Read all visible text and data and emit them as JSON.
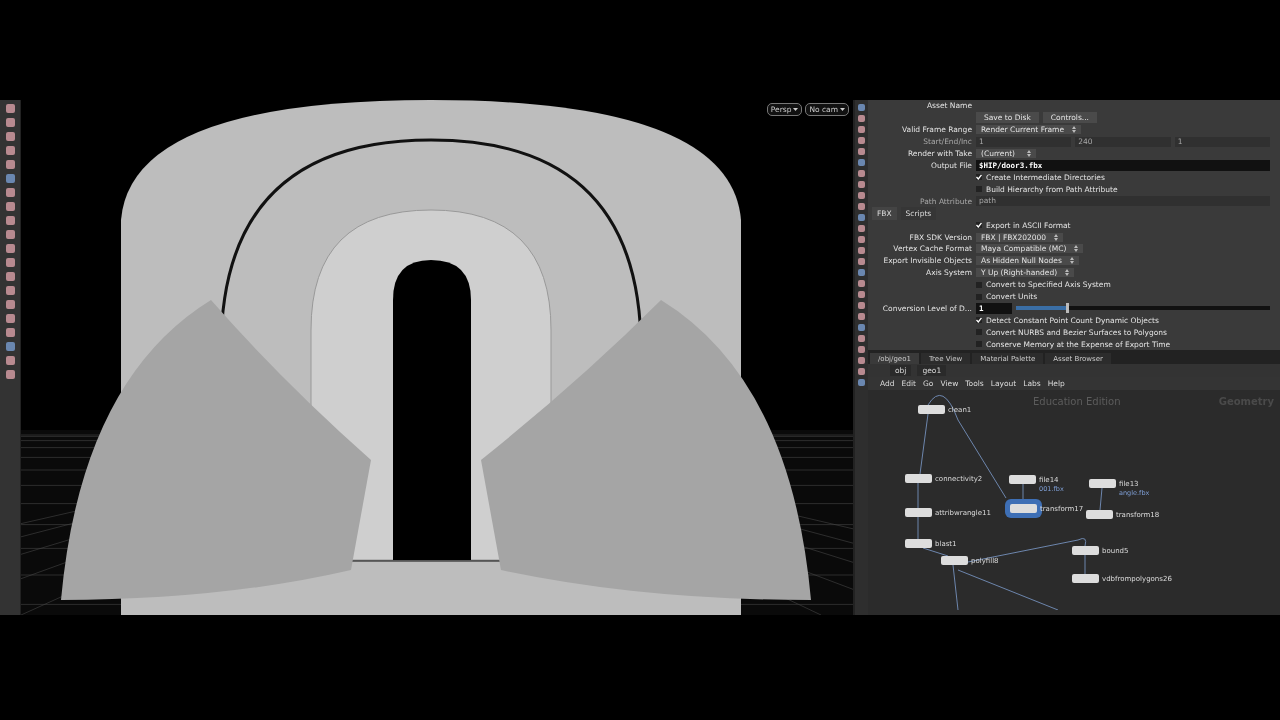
{
  "viewport": {
    "buttons": [
      "Persp",
      "No cam"
    ]
  },
  "parameters": {
    "asset_label": "Asset Name",
    "rows": [
      {
        "kind": "buttons",
        "buttons": [
          "Save to Disk",
          "Controls..."
        ],
        "disabled": false
      },
      {
        "kind": "menu",
        "label": "Valid Frame Range",
        "value": "Render Current Frame",
        "disabled": false
      },
      {
        "kind": "triple",
        "label": "Start/End/Inc",
        "values": [
          "1",
          "240",
          "1"
        ],
        "disabled": true
      },
      {
        "kind": "menu",
        "label": "Render with Take",
        "value": "(Current)",
        "disabled": false
      },
      {
        "kind": "file",
        "label": "Output File",
        "value": "$HIP/door3.fbx",
        "disabled": false
      },
      {
        "kind": "check",
        "label": "Create Intermediate Directories",
        "checked": true,
        "disabled": false
      },
      {
        "kind": "check",
        "label": "Build Hierarchy from Path Attribute",
        "checked": false,
        "disabled": false
      },
      {
        "kind": "field",
        "label": "Path Attribute",
        "value": "path",
        "disabled": true
      },
      {
        "kind": "tabs",
        "tabs": [
          {
            "label": "FBX",
            "selected": true
          },
          {
            "label": "Scripts",
            "selected": false
          }
        ],
        "disabled": false
      },
      {
        "kind": "check",
        "label": "Export in ASCII Format",
        "checked": true,
        "disabled": false
      },
      {
        "kind": "menu",
        "label": "FBX SDK Version",
        "value": "FBX | FBX202000",
        "disabled": false
      },
      {
        "kind": "menu",
        "label": "Vertex Cache Format",
        "value": "Maya Compatible (MC)",
        "disabled": false
      },
      {
        "kind": "menu",
        "label": "Export Invisible Objects",
        "value": "As Hidden Null Nodes",
        "disabled": false
      },
      {
        "kind": "menu",
        "label": "Axis System",
        "value": "Y Up (Right-handed)",
        "disabled": false
      },
      {
        "kind": "check",
        "label": "Convert to Specified Axis System",
        "checked": false,
        "disabled": false
      },
      {
        "kind": "check",
        "label": "Convert Units",
        "checked": false,
        "disabled": false
      },
      {
        "kind": "slider",
        "label": "Conversion Level of D...",
        "value": "1",
        "level": 0.2,
        "disabled": false
      },
      {
        "kind": "check",
        "label": "Detect Constant Point Count Dynamic Objects",
        "checked": true,
        "disabled": false
      },
      {
        "kind": "check",
        "label": "Convert NURBS and Bezier Surfaces to Polygons",
        "checked": false,
        "disabled": false
      },
      {
        "kind": "check",
        "label": "Conserve Memory at the Expense of Export Time",
        "checked": false,
        "disabled": false
      }
    ]
  },
  "network": {
    "tabs": [
      {
        "label": "/obj/geo1",
        "selected": true
      },
      {
        "label": "Tree View",
        "selected": false
      },
      {
        "label": "Material Palette",
        "selected": false
      },
      {
        "label": "Asset Browser",
        "selected": false
      }
    ],
    "path": [
      "obj",
      "geo1"
    ],
    "menu": [
      "Add",
      "Edit",
      "Go",
      "View",
      "Tools",
      "Layout",
      "Labs",
      "Help"
    ],
    "edition": "Education Edition",
    "context": "Geometry",
    "nodes": [
      {
        "name": "clean1",
        "selected": false
      },
      {
        "name": "connectivity2",
        "selected": false
      },
      {
        "name": "attribwrangle11",
        "selected": false
      },
      {
        "name": "blast1",
        "selected": false
      },
      {
        "name": "polyfill8",
        "selected": false
      },
      {
        "name": "file14",
        "sub": "001.fbx",
        "selected": false
      },
      {
        "name": "transform17",
        "selected": true
      },
      {
        "name": "file13",
        "sub": "angle.fbx",
        "selected": false
      },
      {
        "name": "transform18",
        "selected": false
      },
      {
        "name": "bound5",
        "selected": false
      },
      {
        "name": "vdbfrompolygons26",
        "selected": false
      }
    ]
  }
}
